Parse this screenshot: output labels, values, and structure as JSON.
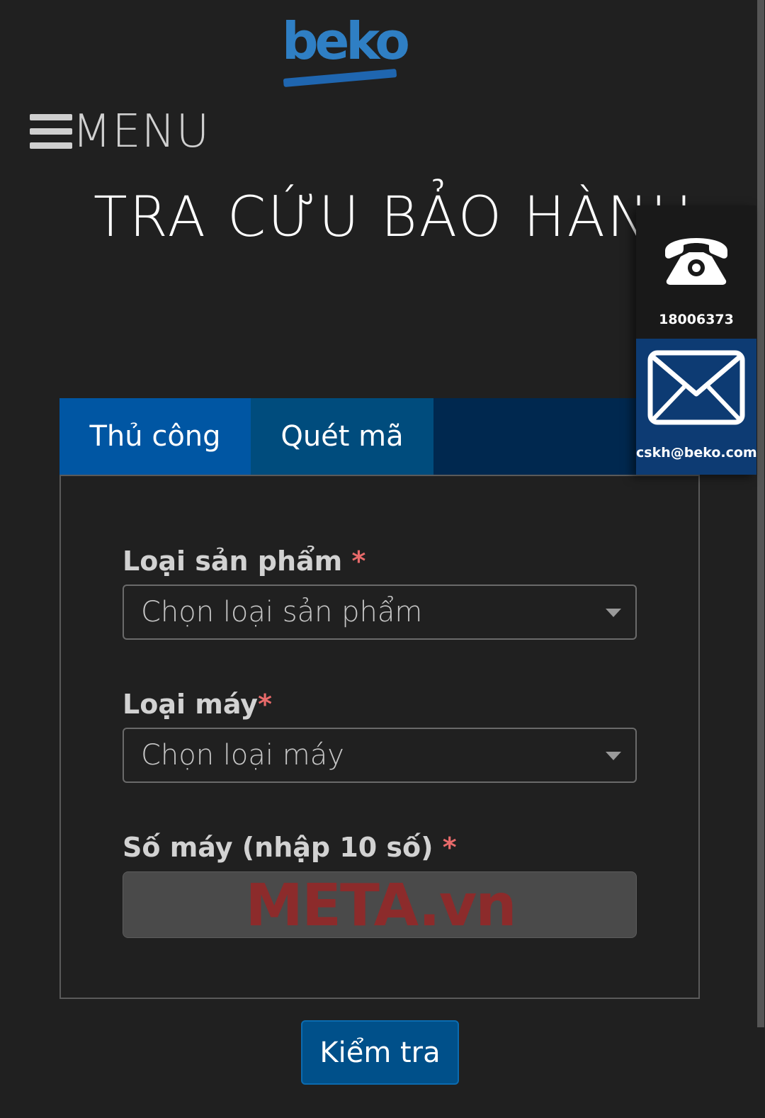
{
  "brand": {
    "logo_text": "beko"
  },
  "menu": {
    "label": "MENU"
  },
  "page": {
    "title": "TRA CỨU BẢO HÀNH"
  },
  "contact": {
    "phone": "18006373",
    "email": "cskh@beko.com"
  },
  "tabs": [
    {
      "label": "Thủ công",
      "active": true
    },
    {
      "label": "Quét mã",
      "active": false
    }
  ],
  "form": {
    "product_type": {
      "label": "Loại sản phẩm ",
      "required_mark": "*",
      "placeholder": "Chọn loại sản phẩm"
    },
    "model_type": {
      "label": "Loại máy",
      "required_mark": "*",
      "placeholder": "Chọn loại máy"
    },
    "serial": {
      "label": "Số máy (nhập 10 số) ",
      "required_mark": "*",
      "watermark": "META.vn"
    },
    "submit_label": "Kiểm tra"
  },
  "colors": {
    "background": "#202020",
    "brand_blue": "#2f7fc4",
    "tab_active": "#0056a3",
    "tab_inactive": "#004c7d",
    "tab_bar": "#00284f",
    "required": "#e86a6a",
    "button": "#00508a"
  }
}
